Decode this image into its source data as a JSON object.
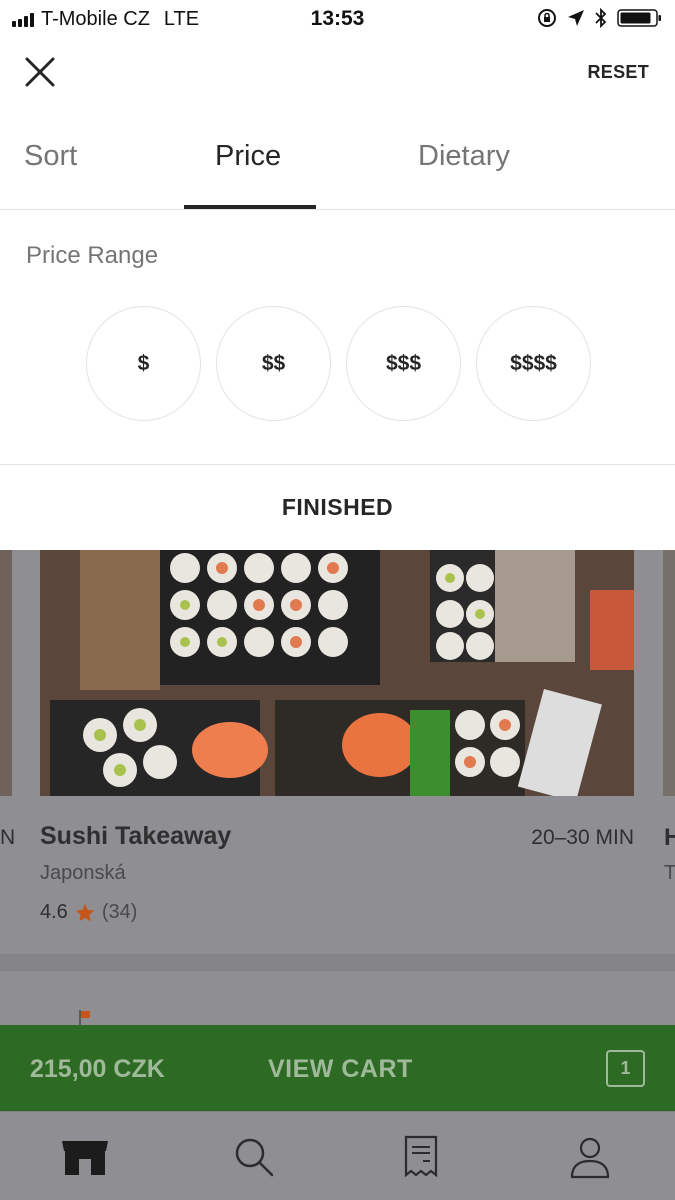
{
  "status_bar": {
    "carrier": "T-Mobile CZ",
    "network": "LTE",
    "time": "13:53",
    "icons": [
      "signal-icon",
      "orientation-lock-icon",
      "location-arrow-icon",
      "bluetooth-icon",
      "battery-icon"
    ]
  },
  "filter_sheet": {
    "close_icon": "close-icon",
    "reset_label": "RESET",
    "tabs": [
      {
        "label": "Sort",
        "active": false
      },
      {
        "label": "Price",
        "active": true
      },
      {
        "label": "Dietary",
        "active": false
      }
    ],
    "section_title": "Price Range",
    "price_options": [
      "$",
      "$$",
      "$$$",
      "$$$$"
    ],
    "finished_label": "FINISHED"
  },
  "background_listing": {
    "left_edge_text": "N",
    "right_edge_text": "H",
    "right_edge_subtext": "T",
    "restaurant": {
      "name": "Sushi Takeaway",
      "eta": "20–30 MIN",
      "cuisine": "Japonská",
      "rating": "4.6",
      "rating_count": "(34)"
    }
  },
  "cart": {
    "total": "215,00 CZK",
    "label": "VIEW CART",
    "item_count": "1"
  },
  "tab_bar": {
    "items": [
      "store-icon",
      "search-icon",
      "receipt-icon",
      "profile-icon"
    ],
    "active": "store-icon"
  },
  "colors": {
    "cart_green": "#2d6a23",
    "star_orange": "#c4561c",
    "overlay_gray": "#8e8e93"
  }
}
